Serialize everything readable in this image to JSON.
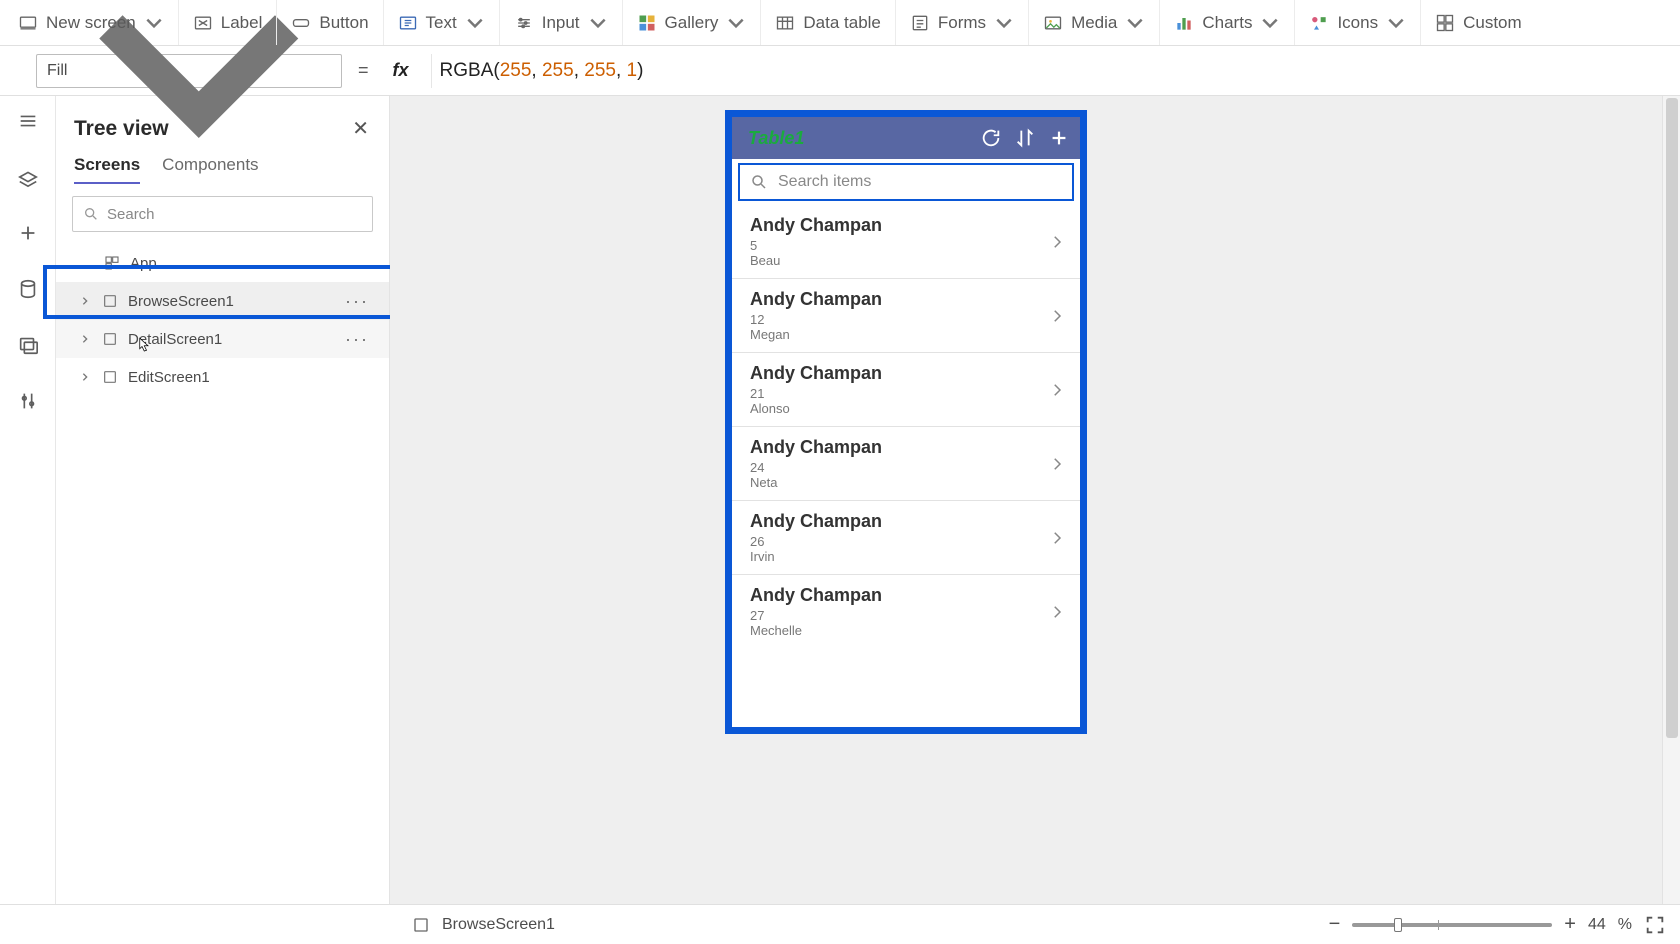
{
  "ribbon": {
    "items": [
      {
        "label": "New screen"
      },
      {
        "label": "Label"
      },
      {
        "label": "Button"
      },
      {
        "label": "Text"
      },
      {
        "label": "Input"
      },
      {
        "label": "Gallery"
      },
      {
        "label": "Data table"
      },
      {
        "label": "Forms"
      },
      {
        "label": "Media"
      },
      {
        "label": "Charts"
      },
      {
        "label": "Icons"
      },
      {
        "label": "Custom"
      }
    ]
  },
  "formula": {
    "property": "Fill",
    "fn": "RGBA",
    "args": [
      "255",
      "255",
      "255",
      "1"
    ]
  },
  "tree": {
    "title": "Tree view",
    "tabs": {
      "screens": "Screens",
      "components": "Components"
    },
    "search_placeholder": "Search",
    "app": "App",
    "nodes": [
      {
        "label": "BrowseScreen1"
      },
      {
        "label": "DetailScreen1"
      },
      {
        "label": "EditScreen1"
      }
    ]
  },
  "device": {
    "title": "Table1",
    "search_placeholder": "Search items",
    "rows": [
      {
        "title": "Andy Champan",
        "sub1": "5",
        "sub2": "Beau"
      },
      {
        "title": "Andy Champan",
        "sub1": "12",
        "sub2": "Megan"
      },
      {
        "title": "Andy Champan",
        "sub1": "21",
        "sub2": "Alonso"
      },
      {
        "title": "Andy Champan",
        "sub1": "24",
        "sub2": "Neta"
      },
      {
        "title": "Andy Champan",
        "sub1": "26",
        "sub2": "Irvin"
      },
      {
        "title": "Andy Champan",
        "sub1": "27",
        "sub2": "Mechelle"
      }
    ]
  },
  "status": {
    "selection": "BrowseScreen1",
    "zoom_value": "44",
    "zoom_unit": "%"
  }
}
